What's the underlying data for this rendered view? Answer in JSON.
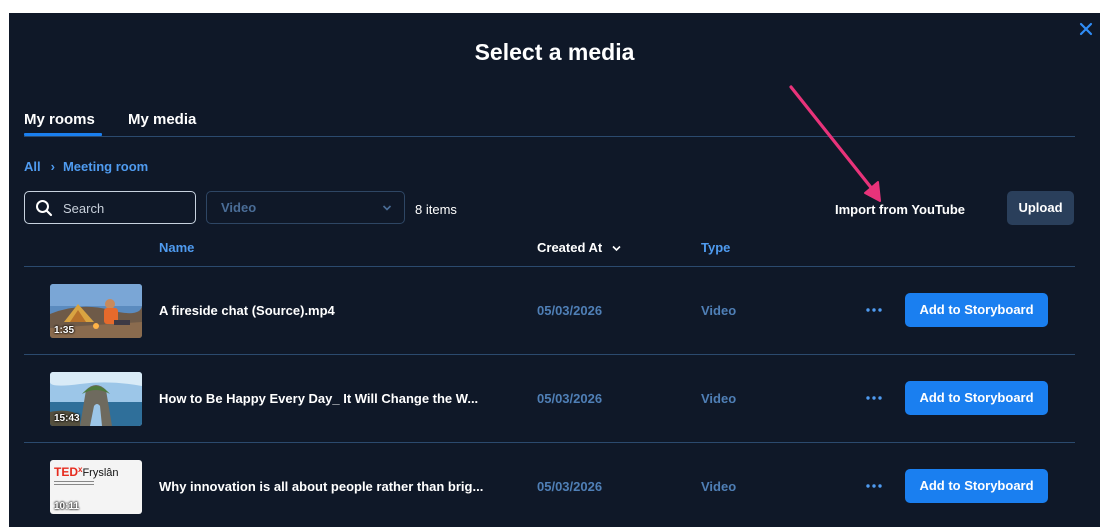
{
  "dialog": {
    "title": "Select a media",
    "close_icon": "close-icon"
  },
  "tabs": [
    {
      "label": "My rooms",
      "active": true
    },
    {
      "label": "My media",
      "active": false
    }
  ],
  "breadcrumb": {
    "root": "All",
    "separator": "›",
    "current": "Meeting room"
  },
  "toolbar": {
    "search_placeholder": "Search",
    "search_value": "",
    "type_filter_value": "Video",
    "item_count": "8 items",
    "import_label": "Import from YouTube",
    "upload_label": "Upload"
  },
  "table": {
    "columns": {
      "name": "Name",
      "created_at": "Created At",
      "type": "Type"
    },
    "sort_icon": "chevron-down-icon",
    "rows": [
      {
        "thumbnail": "fireside-scene",
        "duration": "1:35",
        "name": "A fireside chat (Source).mp4",
        "created_at": "05/03/2026",
        "type": "Video",
        "action_label": "Add to Storyboard"
      },
      {
        "thumbnail": "coastal-rock-scene",
        "duration": "15:43",
        "name": "How to Be Happy Every Day_ It Will Change the W...",
        "created_at": "05/03/2026",
        "type": "Video",
        "action_label": "Add to Storyboard"
      },
      {
        "thumbnail": "tedx-title-card",
        "thumb_logo": "TED",
        "thumb_logo_sup": "x",
        "thumb_logo_city": "Fryslân",
        "duration": "10:11",
        "name": "Why innovation is all about people rather than brig...",
        "created_at": "05/03/2026",
        "type": "Video",
        "action_label": "Add to Storyboard"
      }
    ]
  },
  "colors": {
    "background": "#0f1828",
    "accent": "#1a7ff0",
    "link": "#4f9bf0",
    "divider": "#2b4a6e",
    "annotation_arrow": "#e8337a"
  }
}
